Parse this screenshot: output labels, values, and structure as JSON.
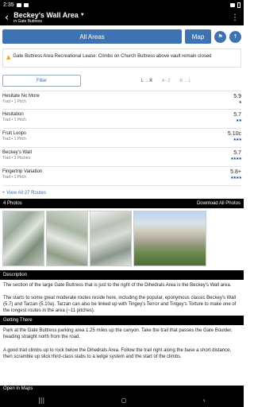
{
  "status": {
    "time": "2:35"
  },
  "header": {
    "title": "Beckey's Wall Area",
    "subtitle": "in Gate Buttress"
  },
  "nav": {
    "all_areas": "All Areas",
    "map": "Map"
  },
  "warning": {
    "text": "Gate Buttress Area Recreational Lease: Climbs on Church Buttress above vault remain closed"
  },
  "filter": {
    "label": "Filter",
    "sort": [
      "L → R",
      "A - Z",
      "R → L"
    ]
  },
  "routes": [
    {
      "name": "Hesitate No More",
      "meta": "Trad • 1 Pitch",
      "grade": "5.9",
      "stars": "★"
    },
    {
      "name": "Hesitation",
      "meta": "Trad • 1 Pitch",
      "grade": "5.7",
      "stars": "★★"
    },
    {
      "name": "Fruit Loops",
      "meta": "Trad • 1 Pitch",
      "grade": "5.10c",
      "stars": "★★★"
    },
    {
      "name": "Beckey's Wall",
      "meta": "Trad • 3 Pitches",
      "grade": "5.7",
      "stars": "★★★★"
    },
    {
      "name": "Fingertrip Variation",
      "meta": "Trad • 1 Pitch",
      "grade": "5.8+",
      "stars": "★★★★"
    }
  ],
  "view_all": "+ View All 27 Routes",
  "photos": {
    "label": "4 Photos",
    "download": "Download All Photos"
  },
  "description": {
    "heading": "Description",
    "p1": "The section of the large Gate Buttress that is just to the right of the Dihedrals Area is the Beckey's Wall area.",
    "p2": "The starts to some great moderate routes reside here, including the popular, eponymous classic Beckey's Wall (5.7) and Tarzan (5.10a). Tarzan can also be linked up with Tingey's Terror and Tingey's Torture to make one of the longest routes in the area (~11 pitches)."
  },
  "getting_there": {
    "heading": "Getting There",
    "p1": "Park at the Gate Buttress parking area 1.25 miles up the canyon. Take the trail that passes the Gate Boulder, heading straight north from the road.",
    "p2": "A good trail climbs up to rock below the Dihedrals Area. Follow the trail right along the base a short distance, then scramble up slick third-class slabs to a ledge system and the start of the climbs."
  },
  "open_maps": "Open in Maps"
}
